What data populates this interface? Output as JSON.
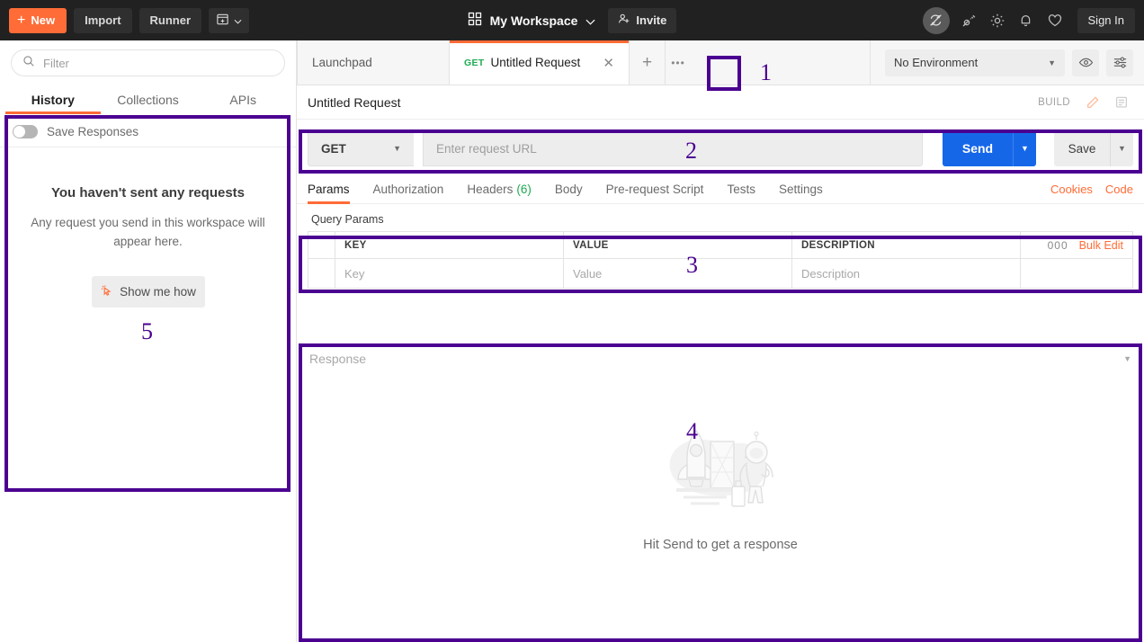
{
  "topbar": {
    "new_label": "New",
    "import_label": "Import",
    "runner_label": "Runner",
    "workspace_label": "My Workspace",
    "invite_label": "Invite",
    "signin_label": "Sign In",
    "icons": [
      "sync-off-icon",
      "satellite-icon",
      "gear-icon",
      "bell-icon",
      "heart-icon"
    ],
    "brand_orange": "#ff6c37",
    "bg": "#212121"
  },
  "sidebar": {
    "filter_placeholder": "Filter",
    "tabs": [
      {
        "label": "History",
        "active": true
      },
      {
        "label": "Collections",
        "active": false
      },
      {
        "label": "APIs",
        "active": false
      }
    ],
    "save_responses_label": "Save Responses",
    "save_responses_on": false,
    "empty_title": "You haven't sent any requests",
    "empty_sub": "Any request you send in this workspace will appear here.",
    "show_me_how_label": "Show me how"
  },
  "tabstrip": {
    "tabs": [
      {
        "label": "Launchpad",
        "method": "",
        "active": false,
        "closable": false
      },
      {
        "label": "Untitled Request",
        "method": "GET",
        "active": true,
        "closable": true
      }
    ],
    "add_tab_label": "+",
    "more_label": "000",
    "environment_value": "No Environment",
    "env_icons": [
      "eye-icon",
      "sliders-icon"
    ]
  },
  "request": {
    "title": "Untitled Request",
    "build_label": "BUILD",
    "method": "GET",
    "url_placeholder": "Enter request URL",
    "send_label": "Send",
    "save_label": "Save",
    "tabs": [
      {
        "label": "Params",
        "count": "",
        "active": true
      },
      {
        "label": "Authorization",
        "count": "",
        "active": false
      },
      {
        "label": "Headers",
        "count": "(6)",
        "active": false
      },
      {
        "label": "Body",
        "count": "",
        "active": false
      },
      {
        "label": "Pre-request Script",
        "count": "",
        "active": false
      },
      {
        "label": "Tests",
        "count": "",
        "active": false
      },
      {
        "label": "Settings",
        "count": "",
        "active": false
      }
    ],
    "links": [
      {
        "label": "Cookies"
      },
      {
        "label": "Code"
      }
    ]
  },
  "params": {
    "section_label": "Query Params",
    "headers": [
      "KEY",
      "VALUE",
      "DESCRIPTION"
    ],
    "rows": [
      {
        "key": "Key",
        "value": "Value",
        "description": "Description"
      }
    ],
    "bulk_edit_label": "Bulk Edit",
    "more_label": "000"
  },
  "response": {
    "label": "Response",
    "empty_message": "Hit Send to get a response",
    "illustration": "rocket-astronaut-illustration"
  },
  "annotations": {
    "color": "#4b0091",
    "markers": [
      {
        "number": "1",
        "target": "new-tab-button"
      },
      {
        "number": "2",
        "target": "url-bar"
      },
      {
        "number": "3",
        "target": "query-params-table"
      },
      {
        "number": "4",
        "target": "response-pane"
      },
      {
        "number": "5",
        "target": "history-sidebar-panel"
      }
    ]
  }
}
